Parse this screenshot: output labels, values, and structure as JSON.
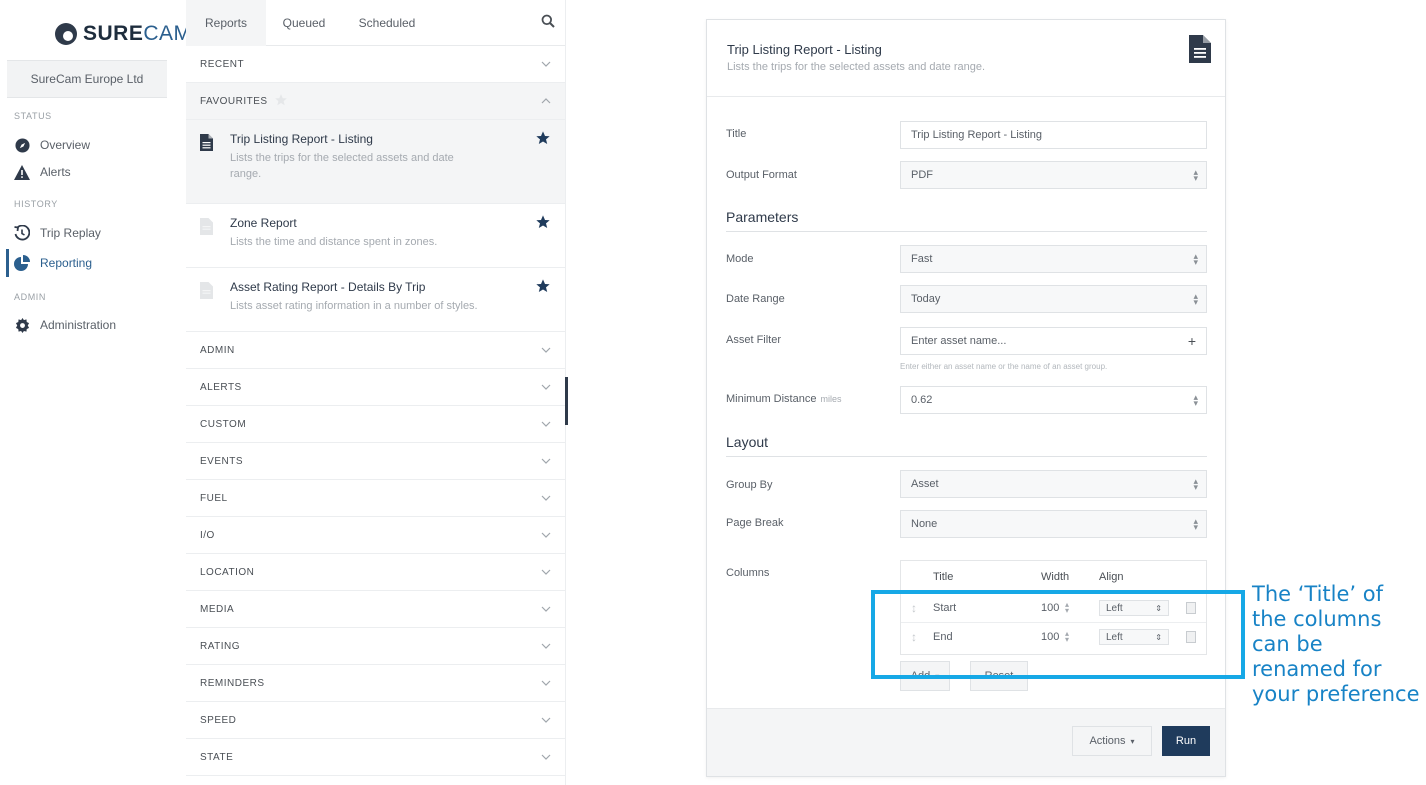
{
  "brand": {
    "logo_text_a": "SURE",
    "logo_text_b": "CAM"
  },
  "nav": {
    "org": "SureCam Europe Ltd",
    "sections": [
      {
        "heading": "STATUS",
        "items": [
          {
            "label": "Overview",
            "icon": "compass-icon"
          },
          {
            "label": "Alerts",
            "icon": "warning-icon"
          }
        ]
      },
      {
        "heading": "HISTORY",
        "items": [
          {
            "label": "Trip Replay",
            "icon": "history-icon"
          },
          {
            "label": "Reporting",
            "icon": "pie-chart-icon",
            "active": true
          }
        ]
      },
      {
        "heading": "ADMIN",
        "items": [
          {
            "label": "Administration",
            "icon": "gear-icon"
          }
        ]
      }
    ]
  },
  "reports": {
    "tabs": [
      "Reports",
      "Queued",
      "Scheduled"
    ],
    "recent": "RECENT",
    "favourites": "FAVOURITES",
    "favourite_items": [
      {
        "title": "Trip Listing Report - Listing",
        "desc_1": "Lists the trips for the selected assets and date",
        "desc_2": "range."
      },
      {
        "title": "Zone Report",
        "desc_1": "Lists the time and distance spent in zones.",
        "desc_2": ""
      },
      {
        "title": "Asset Rating Report - Details By Trip",
        "desc_1": "Lists asset rating information in a number of styles.",
        "desc_2": ""
      }
    ],
    "groups": [
      "ADMIN",
      "ALERTS",
      "CUSTOM",
      "EVENTS",
      "FUEL",
      "I/O",
      "LOCATION",
      "MEDIA",
      "RATING",
      "REMINDERS",
      "SPEED",
      "STATE"
    ]
  },
  "form": {
    "title": "Trip Listing Report - Listing",
    "subtitle": "Lists the trips for the selected assets and date range.",
    "title_label": "Title",
    "title_value": "Trip Listing Report - Listing",
    "output_label": "Output Format",
    "output_value": "PDF",
    "parameters_heading": "Parameters",
    "mode_label": "Mode",
    "mode_value": "Fast",
    "date_range_label": "Date Range",
    "date_range_value": "Today",
    "asset_filter_label": "Asset Filter",
    "asset_filter_placeholder": "Enter asset name...",
    "asset_filter_hint": "Enter either an asset name or the name of an asset group.",
    "min_distance_label": "Minimum Distance",
    "min_distance_unit": "miles",
    "min_distance_value": "0.62",
    "layout_heading": "Layout",
    "group_by_label": "Group By",
    "group_by_value": "Asset",
    "page_break_label": "Page Break",
    "page_break_value": "None",
    "columns_label": "Columns",
    "columns_headers": {
      "title": "Title",
      "width": "Width",
      "align": "Align"
    },
    "columns_rows": [
      {
        "title": "Start",
        "width": "100",
        "align": "Left"
      },
      {
        "title": "End",
        "width": "100",
        "align": "Left"
      }
    ],
    "add_button": "Add",
    "reset_button": "Reset",
    "actions_button": "Actions",
    "run_button": "Run"
  },
  "annotation": {
    "callout": "The ‘Title’ of the columns can be renamed for your preference",
    "color": "#16a8e6"
  }
}
